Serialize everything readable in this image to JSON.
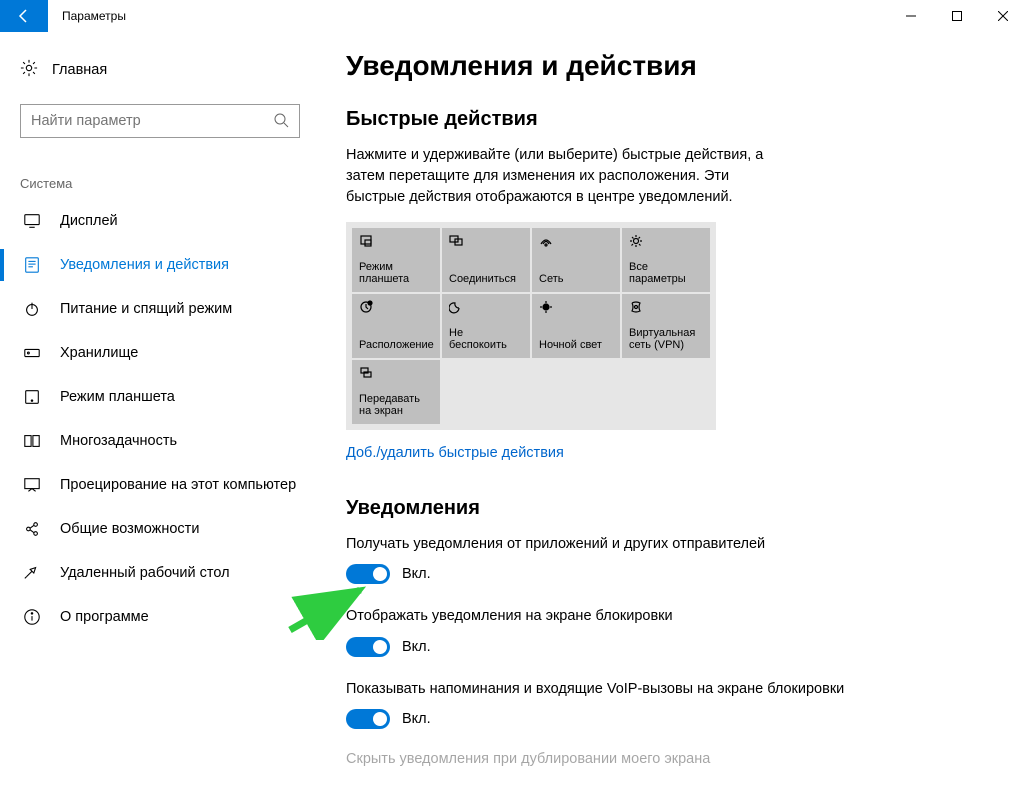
{
  "window": {
    "title": "Параметры"
  },
  "sidebar": {
    "home": "Главная",
    "search_placeholder": "Найти параметр",
    "section_label": "Система",
    "items": [
      {
        "label": "Дисплей",
        "icon": "display"
      },
      {
        "label": "Уведомления и действия",
        "icon": "notifications",
        "active": true
      },
      {
        "label": "Питание и спящий режим",
        "icon": "power"
      },
      {
        "label": "Хранилище",
        "icon": "storage"
      },
      {
        "label": "Режим планшета",
        "icon": "tablet"
      },
      {
        "label": "Многозадачность",
        "icon": "multitask"
      },
      {
        "label": "Проецирование на этот компьютер",
        "icon": "project"
      },
      {
        "label": "Общие возможности",
        "icon": "shared"
      },
      {
        "label": "Удаленный рабочий стол",
        "icon": "remote"
      },
      {
        "label": "О программе",
        "icon": "about"
      }
    ]
  },
  "main": {
    "title": "Уведомления и действия",
    "quick_actions": {
      "heading": "Быстрые действия",
      "description": "Нажмите и удерживайте (или выберите) быстрые действия, а затем перетащите для изменения их расположения. Эти быстрые действия отображаются в центре уведомлений.",
      "tiles": [
        [
          {
            "label": "Режим планшета"
          },
          {
            "label": "Соединиться"
          },
          {
            "label": "Сеть"
          },
          {
            "label": "Все параметры"
          }
        ],
        [
          {
            "label": "Расположение"
          },
          {
            "label": "Не беспокоить"
          },
          {
            "label": "Ночной свет"
          },
          {
            "label": "Виртуальная сеть (VPN)"
          }
        ],
        [
          {
            "label": "Передавать на экран"
          }
        ]
      ],
      "edit_link": "Доб./удалить быстрые действия"
    },
    "notifications": {
      "heading": "Уведомления",
      "settings": [
        {
          "label": "Получать уведомления от приложений и других отправителей",
          "state": "Вкл."
        },
        {
          "label": "Отображать уведомления на экране блокировки",
          "state": "Вкл."
        },
        {
          "label": "Показывать напоминания и входящие VoIP-вызовы на экране блокировки",
          "state": "Вкл."
        }
      ],
      "truncated_line": "Скрыть уведомления при дублировании моего экрана"
    }
  }
}
